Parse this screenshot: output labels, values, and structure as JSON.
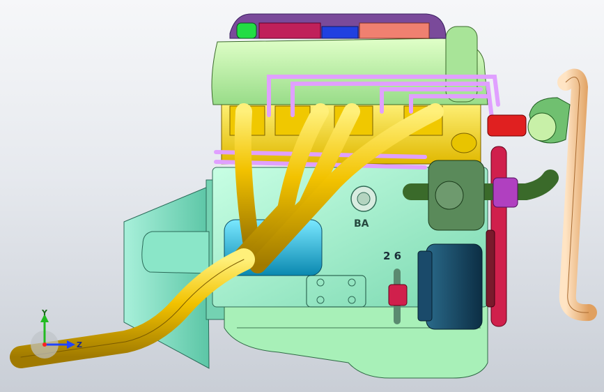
{
  "viewport": {
    "background_top": "#f6f7f9",
    "background_bottom": "#c9ced6"
  },
  "model": {
    "engine_marking": "2 6",
    "block_text": "BA"
  },
  "triad": {
    "y_label": "Y",
    "z_label": "Z",
    "colors": {
      "y": "#22bb22",
      "z": "#2244ff",
      "origin": "#ff2222"
    }
  },
  "colors": {
    "rocker_cover": "#b8f0a0",
    "cylinder_head": "#ffd800",
    "block": "#9af0c8",
    "oil_pan": "#a8f0b8",
    "exhaust": "#f2c200",
    "bellhousing": "#8ee8cc",
    "starter": "#22b8e0",
    "pulley": "#d0204c",
    "intake_pipe": "#3a6a2a",
    "outlet_pipe": "#ffc890",
    "alternator": "#1a4a6a",
    "fuel_lines": "#e0a0ff",
    "red_fitting": "#e02020",
    "lid_purple": "#7a4a9a",
    "lid_magenta": "#c0205a",
    "lid_blue": "#2040e0",
    "lid_salmon": "#f08070"
  }
}
